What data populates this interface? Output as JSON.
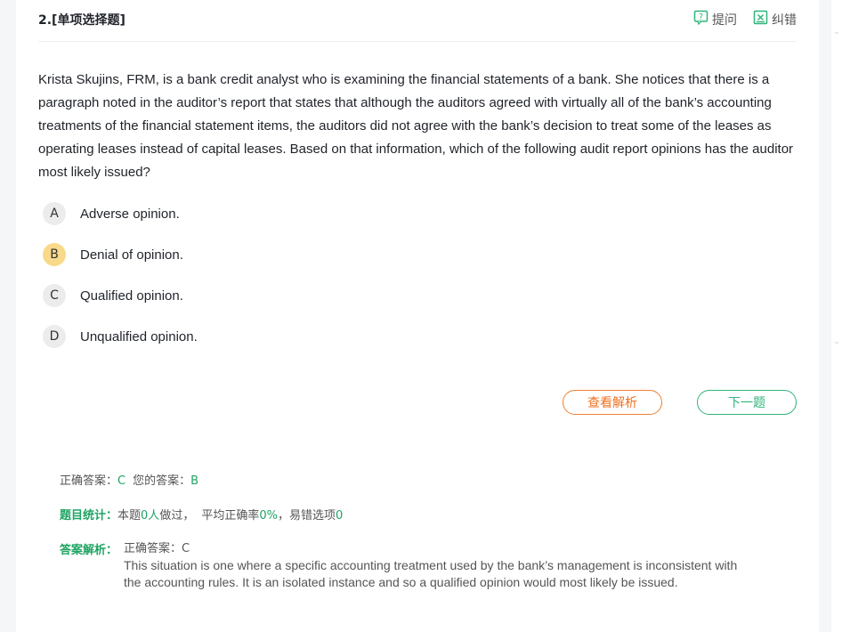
{
  "question": {
    "header": "2.[单项选择题]",
    "tools": {
      "ask_label": "提问",
      "report_label": "纠错"
    },
    "stem": "Krista Skujins, FRM, is a bank credit analyst who is examining the financial statements of a bank. She notices that there is a paragraph noted in the auditor’s report that states that although the auditors agreed with virtually all of the bank’s accounting treatments of the financial statement items, the auditors did not agree with the bank’s decision to treat some of the leases as operating leases instead of capital leases. Based on that information, which of the following audit report opinions has the auditor most likely issued?",
    "options": [
      {
        "letter": "A",
        "text": "Adverse opinion."
      },
      {
        "letter": "B",
        "text": "Denial of opinion."
      },
      {
        "letter": "C",
        "text": "Qualified opinion."
      },
      {
        "letter": "D",
        "text": "Unqualified opinion."
      }
    ],
    "selected": "B"
  },
  "buttons": {
    "analysis": "查看解析",
    "next": "下一题"
  },
  "result": {
    "correct_label": "正确答案：",
    "correct_value": "C",
    "your_label": "您的答案：",
    "your_value": "B",
    "stats_label": "题目统计：",
    "stats_prefix": "本题",
    "stats_count": "0人",
    "stats_mid": "做过，",
    "stats_rate_label": "平均正确率",
    "stats_rate": "0%",
    "stats_err_label": "，易错选项",
    "stats_err": "0",
    "explain_label": "答案解析：",
    "explain_answer": "正确答案：C",
    "explain_text": "This situation is one where a specific accounting treatment used by the bank’s management is inconsistent with the accounting rules. It is an isolated instance and so a qualified opinion would most likely be issued."
  },
  "colors": {
    "green": "#1fa463",
    "orange": "#f07020",
    "selected_badge": "#f9d98a"
  }
}
